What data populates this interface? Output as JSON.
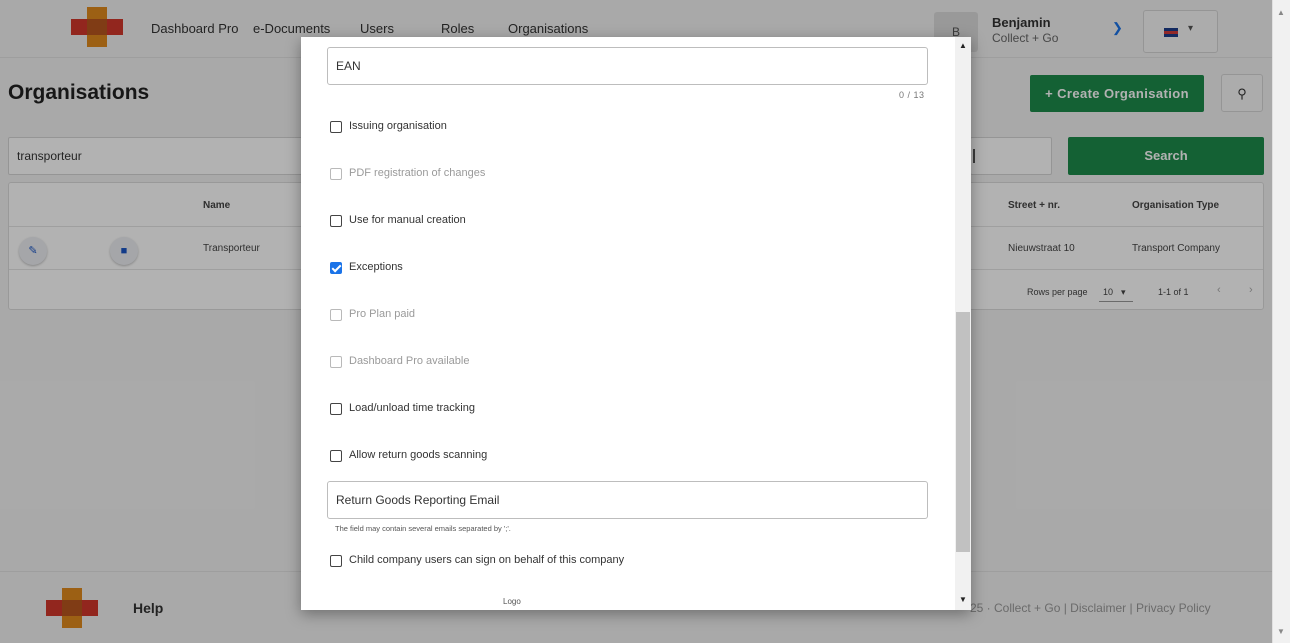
{
  "nav": {
    "items": [
      "Dashboard Pro",
      "e-Documents",
      "Users",
      "Roles",
      "Organisations"
    ]
  },
  "user": {
    "initial": "B",
    "name": "Benjamin",
    "company": "Collect + Go",
    "language_icon": "uk-flag-icon"
  },
  "page": {
    "title": "Organisations",
    "create_button": "+ Create Organisation",
    "search_value": "transporteur",
    "search_button": "Search"
  },
  "table": {
    "headers": {
      "name": "Name",
      "street": "Street + nr.",
      "type": "Organisation Type"
    },
    "row": {
      "name": "Transporteur",
      "street": "Nieuwstraat 10",
      "type": "Transport Company"
    },
    "pagination": {
      "rows_per_page_label": "Rows per page",
      "rows_per_page": "10",
      "range": "1-1 of 1"
    }
  },
  "footer": {
    "help": "Help",
    "links": "25 · Collect + Go   |   Disclaimer   |   Privacy Policy"
  },
  "modal": {
    "ean_label": "EAN",
    "ean_counter": "0 / 13",
    "checkboxes": [
      {
        "label": "Issuing organisation",
        "checked": false,
        "disabled": false
      },
      {
        "label": "PDF registration of changes",
        "checked": false,
        "disabled": true
      },
      {
        "label": "Use for manual creation",
        "checked": false,
        "disabled": false
      },
      {
        "label": "Exceptions",
        "checked": true,
        "disabled": false
      },
      {
        "label": "Pro Plan paid",
        "checked": false,
        "disabled": true
      },
      {
        "label": "Dashboard Pro available",
        "checked": false,
        "disabled": true
      },
      {
        "label": "Load/unload time tracking",
        "checked": false,
        "disabled": false
      },
      {
        "label": "Allow return goods scanning",
        "checked": false,
        "disabled": false
      }
    ],
    "return_email_label": "Return Goods Reporting Email",
    "return_email_hint": "The field may contain several emails separated by ';'.",
    "child_company": {
      "label": "Child company users can sign on behalf of this company",
      "checked": false,
      "disabled": false
    },
    "logo_label": "Logo"
  },
  "colors": {
    "primary_green": "#1d8b4b",
    "accent_blue": "#1a73e8"
  }
}
